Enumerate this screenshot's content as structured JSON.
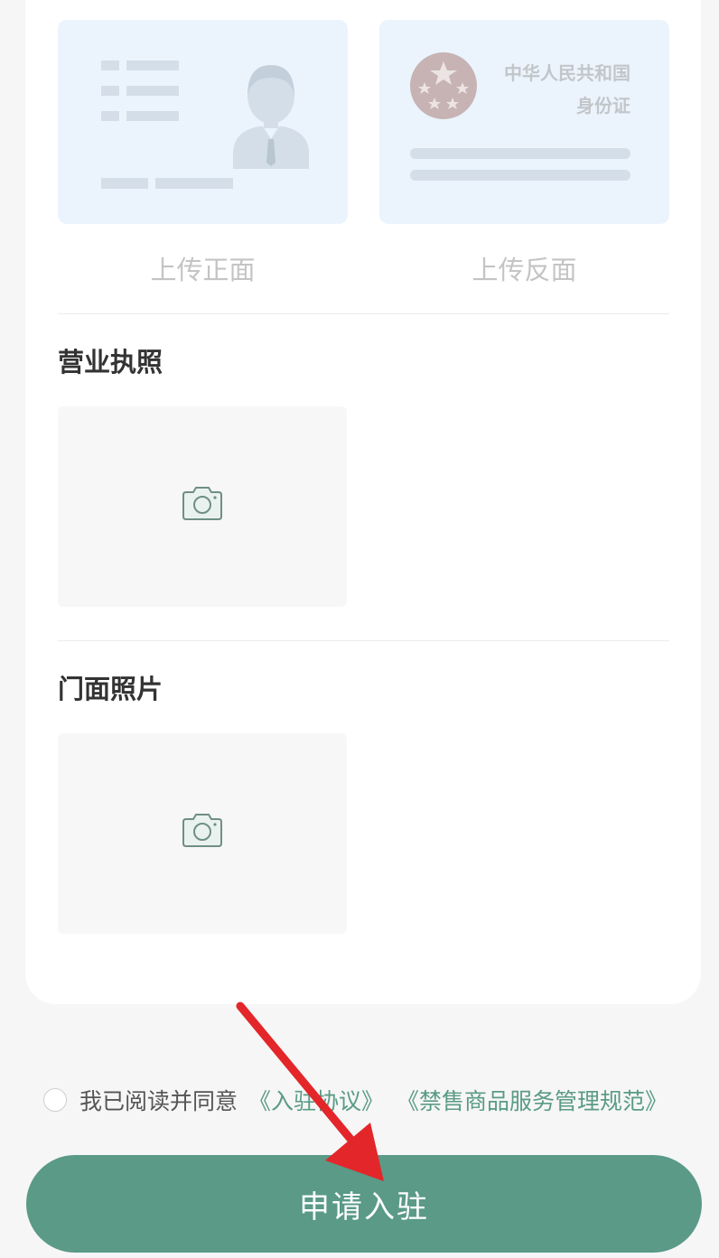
{
  "id_upload": {
    "front_label": "上传正面",
    "back_label": "上传反面",
    "back_card_title": "中华人民共和国",
    "back_card_subtitle": "身份证"
  },
  "business_license": {
    "title": "营业执照",
    "upload_icon": "camera-icon"
  },
  "storefront_photo": {
    "title": "门面照片",
    "upload_icon": "camera-icon"
  },
  "agreement": {
    "prefix": "我已阅读并同意",
    "link1": "《入驻协议》",
    "link2": "《禁售商品服务管理规范》"
  },
  "submit": {
    "label": "申请入驻"
  },
  "colors": {
    "accent": "#5a9a87",
    "link": "#5a9b86",
    "annotation_arrow": "#e3262a"
  }
}
